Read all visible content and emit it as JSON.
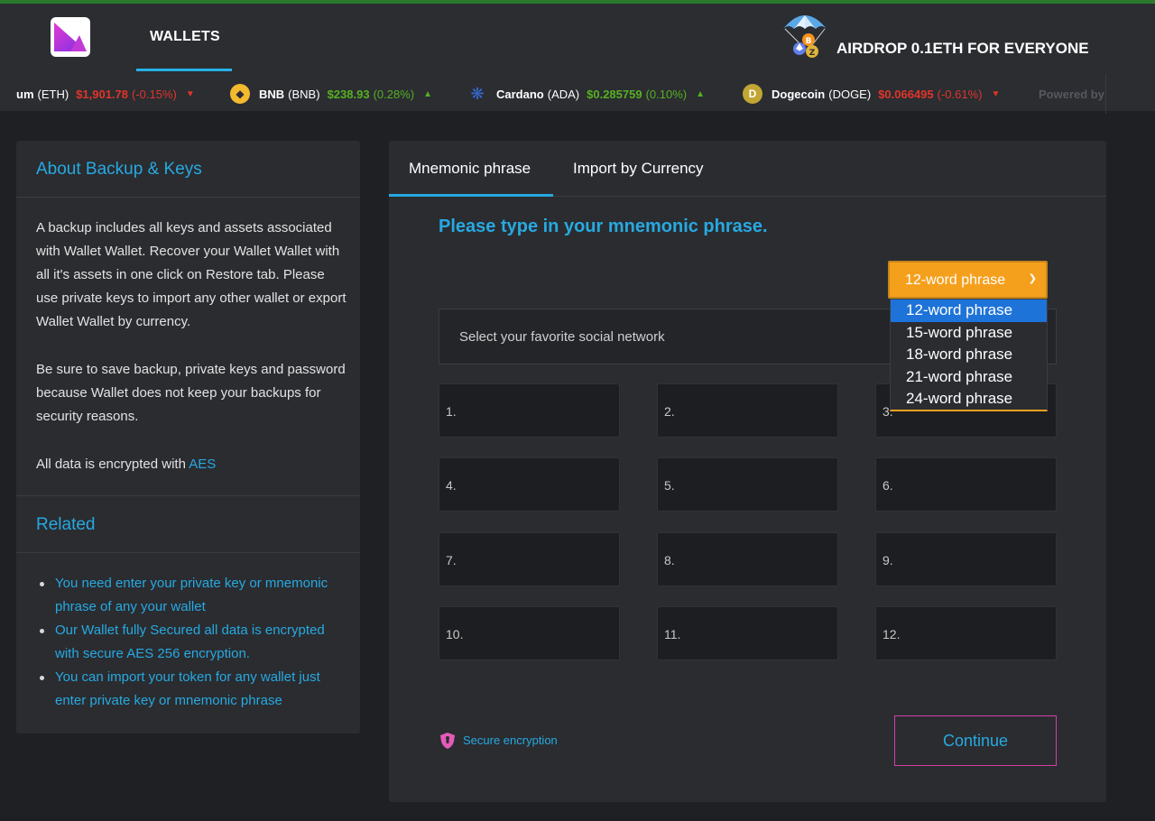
{
  "header": {
    "nav_wallets": "WALLETS",
    "airdrop": "AIRDROP 0.1ETH FOR EVERYONE"
  },
  "ticker": [
    {
      "name": "um",
      "symbol": "(ETH)",
      "price": "$1,901.78",
      "change": "(-0.15%)",
      "direction": "down",
      "icon": "ethereum-icon"
    },
    {
      "name": "BNB",
      "symbol": "(BNB)",
      "price": "$238.93",
      "change": "(0.28%)",
      "direction": "up",
      "icon": "bnb-icon"
    },
    {
      "name": "Cardano",
      "symbol": "(ADA)",
      "price": "$0.285759",
      "change": "(0.10%)",
      "direction": "up",
      "icon": "cardano-icon"
    },
    {
      "name": "Dogecoin",
      "symbol": "(DOGE)",
      "price": "$0.066495",
      "change": "(-0.61%)",
      "direction": "down",
      "icon": "dogecoin-icon"
    }
  ],
  "ticker_powered": "Powered by",
  "sidebar": {
    "about_title": "About Backup & Keys",
    "about_p1": "A backup includes all keys and assets associated with Wallet Wallet. Recover your Wallet Wallet with all it's assets in one click on Restore tab. Please use private keys to import any other wallet or export Wallet Wallet by currency.",
    "about_p2": "Be sure to save backup, private keys and password because Wallet does not keep your backups for security reasons.",
    "about_p3_prefix": "All data is encrypted with ",
    "about_p3_link": "AES",
    "related_title": "Related",
    "related_items": [
      "You need enter your private key or mnemonic phrase of any your wallet",
      "Our Wallet fully Secured all data is encrypted with secure AES 256 encryption.",
      "You can import your token for any wallet just enter private key or mnemonic phrase"
    ]
  },
  "main": {
    "tabs": [
      "Mnemonic phrase",
      "Import by Currency"
    ],
    "active_tab": "Mnemonic phrase",
    "prompt": "Please type in your mnemonic phrase.",
    "social_placeholder": "Select your favorite social network",
    "phrase_select": {
      "selected": "12-word phrase",
      "options": [
        "12-word phrase",
        "15-word phrase",
        "18-word phrase",
        "21-word phrase",
        "24-word phrase"
      ]
    },
    "word_labels": [
      "1.",
      "2.",
      "3.",
      "4.",
      "5.",
      "6.",
      "7.",
      "8.",
      "9.",
      "10.",
      "11.",
      "12."
    ],
    "secure_text": "Secure encryption",
    "continue_label": "Continue"
  },
  "colors": {
    "accent_blue": "#27a9e1",
    "select_orange": "#f5a01d",
    "continue_border": "#d43fa8",
    "price_up": "#57b021",
    "price_down": "#e0352b"
  }
}
